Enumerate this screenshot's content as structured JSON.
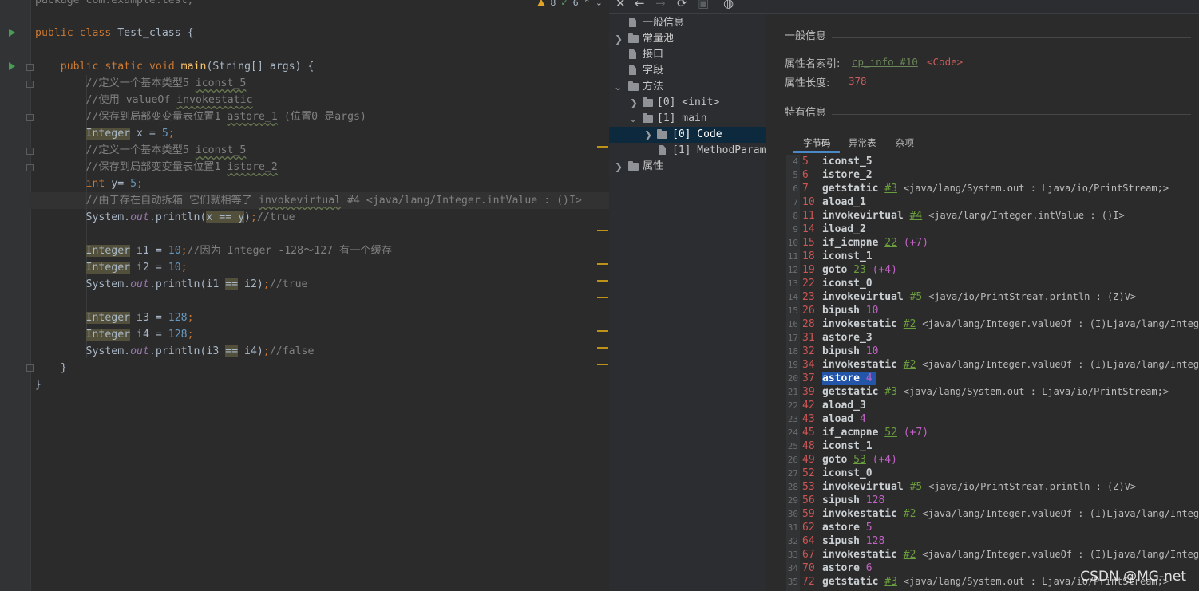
{
  "editor": {
    "package_line": "package com.example.test;",
    "inspections": {
      "warnings": "8",
      "checks": "6"
    },
    "lines": [
      {
        "n": "l1",
        "text": "public class Test_class {"
      },
      {
        "n": "l2",
        "text": "    public static void main(String[] args) {"
      },
      {
        "n": "l3",
        "text": "        //定义一个基本类型5 iconst_5"
      },
      {
        "n": "l4",
        "text": "        //使用 valueOf invokestatic"
      },
      {
        "n": "l5",
        "text": "        //保存到局部变变量表位置1 astore_1 (位置0 是args)"
      },
      {
        "n": "l6",
        "text": "        Integer x = 5;"
      },
      {
        "n": "l7",
        "text": "        //定义一个基本类型5 iconst_5"
      },
      {
        "n": "l8",
        "text": "        //保存到局部变变量表位置1 istore_2"
      },
      {
        "n": "l9",
        "text": "        int y= 5;"
      },
      {
        "n": "l10",
        "text": "        //由于存在自动拆箱 它们就相等了 invokevirtual #4 <java/lang/Integer.intValue : ()I>"
      },
      {
        "n": "l11",
        "text": "        System.out.println(x == y);//true"
      },
      {
        "n": "l12",
        "text": "        Integer i1 = 10;//因为 Integer -128～127 有一个缓存"
      },
      {
        "n": "l13",
        "text": "        Integer i2 = 10;"
      },
      {
        "n": "l14",
        "text": "        System.out.println(i1 == i2);//true"
      },
      {
        "n": "l15",
        "text": "        Integer i3 = 128;"
      },
      {
        "n": "l16",
        "text": "        Integer i4 = 128;"
      },
      {
        "n": "l17",
        "text": "        System.out.println(i3 == i4);//false"
      },
      {
        "n": "l18",
        "text": "    }"
      },
      {
        "n": "l19",
        "text": "}"
      }
    ]
  },
  "toolbar": {
    "close": "✕",
    "back": "←",
    "forward": "→",
    "refresh": "⟳",
    "save": "▣",
    "web": "◍"
  },
  "tree": {
    "items": [
      {
        "label": "一般信息"
      },
      {
        "label": "常量池"
      },
      {
        "label": "接口"
      },
      {
        "label": "字段"
      },
      {
        "label": "方法"
      },
      {
        "label": "[0] <init>"
      },
      {
        "label": "[1] main"
      },
      {
        "label": "[0] Code"
      },
      {
        "label": "[1] MethodParame"
      },
      {
        "label": "属性"
      }
    ]
  },
  "details": {
    "general_title": "一般信息",
    "attr_name_index_label": "属性名索引:",
    "attr_name_index_link": "cp_info #10",
    "attr_name_index_value": "<Code>",
    "attr_length_label": "属性长度:",
    "attr_length_value": "378",
    "specific_title": "特有信息",
    "tabs": [
      "字节码",
      "异常表",
      "杂项"
    ]
  },
  "bytecode": [
    {
      "ln": "4",
      "off": "5",
      "op": "iconst_5"
    },
    {
      "ln": "5",
      "off": "6",
      "op": "istore_2"
    },
    {
      "ln": "6",
      "off": "7",
      "op": "getstatic",
      "ref": "#3",
      "cmt": "<java/lang/System.out : Ljava/io/PrintStream;>"
    },
    {
      "ln": "7",
      "off": "10",
      "op": "aload_1"
    },
    {
      "ln": "8",
      "off": "11",
      "op": "invokevirtual",
      "ref": "#4",
      "cmt": "<java/lang/Integer.intValue : ()I>"
    },
    {
      "ln": "9",
      "off": "14",
      "op": "iload_2"
    },
    {
      "ln": "10",
      "off": "15",
      "op": "if_icmpne",
      "ref": "22",
      "arg": "(+7)"
    },
    {
      "ln": "11",
      "off": "18",
      "op": "iconst_1"
    },
    {
      "ln": "12",
      "off": "19",
      "op": "goto",
      "ref": "23",
      "arg": "(+4)"
    },
    {
      "ln": "13",
      "off": "22",
      "op": "iconst_0"
    },
    {
      "ln": "14",
      "off": "23",
      "op": "invokevirtual",
      "ref": "#5",
      "cmt": "<java/io/PrintStream.println : (Z)V>"
    },
    {
      "ln": "15",
      "off": "26",
      "op": "bipush",
      "arg": "10"
    },
    {
      "ln": "16",
      "off": "28",
      "op": "invokestatic",
      "ref": "#2",
      "cmt": "<java/lang/Integer.valueOf : (I)Ljava/lang/Integ"
    },
    {
      "ln": "17",
      "off": "31",
      "op": "astore_3"
    },
    {
      "ln": "18",
      "off": "32",
      "op": "bipush",
      "arg": "10"
    },
    {
      "ln": "19",
      "off": "34",
      "op": "invokestatic",
      "ref": "#2",
      "cmt": "<java/lang/Integer.valueOf : (I)Ljava/lang/Integ"
    },
    {
      "ln": "20",
      "off": "37",
      "op": "astore",
      "arg": "4",
      "sel": true
    },
    {
      "ln": "21",
      "off": "39",
      "op": "getstatic",
      "ref": "#3",
      "cmt": "<java/lang/System.out : Ljava/io/PrintStream;>"
    },
    {
      "ln": "22",
      "off": "42",
      "op": "aload_3"
    },
    {
      "ln": "23",
      "off": "43",
      "op": "aload",
      "arg": "4"
    },
    {
      "ln": "24",
      "off": "45",
      "op": "if_acmpne",
      "ref": "52",
      "arg": "(+7)"
    },
    {
      "ln": "25",
      "off": "48",
      "op": "iconst_1"
    },
    {
      "ln": "26",
      "off": "49",
      "op": "goto",
      "ref": "53",
      "arg": "(+4)"
    },
    {
      "ln": "27",
      "off": "52",
      "op": "iconst_0"
    },
    {
      "ln": "28",
      "off": "53",
      "op": "invokevirtual",
      "ref": "#5",
      "cmt": "<java/io/PrintStream.println : (Z)V>"
    },
    {
      "ln": "29",
      "off": "56",
      "op": "sipush",
      "arg": "128"
    },
    {
      "ln": "30",
      "off": "59",
      "op": "invokestatic",
      "ref": "#2",
      "cmt": "<java/lang/Integer.valueOf : (I)Ljava/lang/Integ"
    },
    {
      "ln": "31",
      "off": "62",
      "op": "astore",
      "arg": "5"
    },
    {
      "ln": "32",
      "off": "64",
      "op": "sipush",
      "arg": "128"
    },
    {
      "ln": "33",
      "off": "67",
      "op": "invokestatic",
      "ref": "#2",
      "cmt": "<java/lang/Integer.valueOf : (I)Ljava/lang/Integ"
    },
    {
      "ln": "34",
      "off": "70",
      "op": "astore",
      "arg": "6"
    },
    {
      "ln": "35",
      "off": "72",
      "op": "getstatic",
      "ref": "#3",
      "cmt": "<java/lang/System.out : Ljava/io/PrintStream;>"
    }
  ],
  "watermark": "CSDN @MG-net",
  "colors": {
    "selection": "#2355a8",
    "offset": "#cc5555",
    "ref": "#6a9e3c",
    "arg": "#c261c6",
    "warning_marker": "#be9117"
  }
}
